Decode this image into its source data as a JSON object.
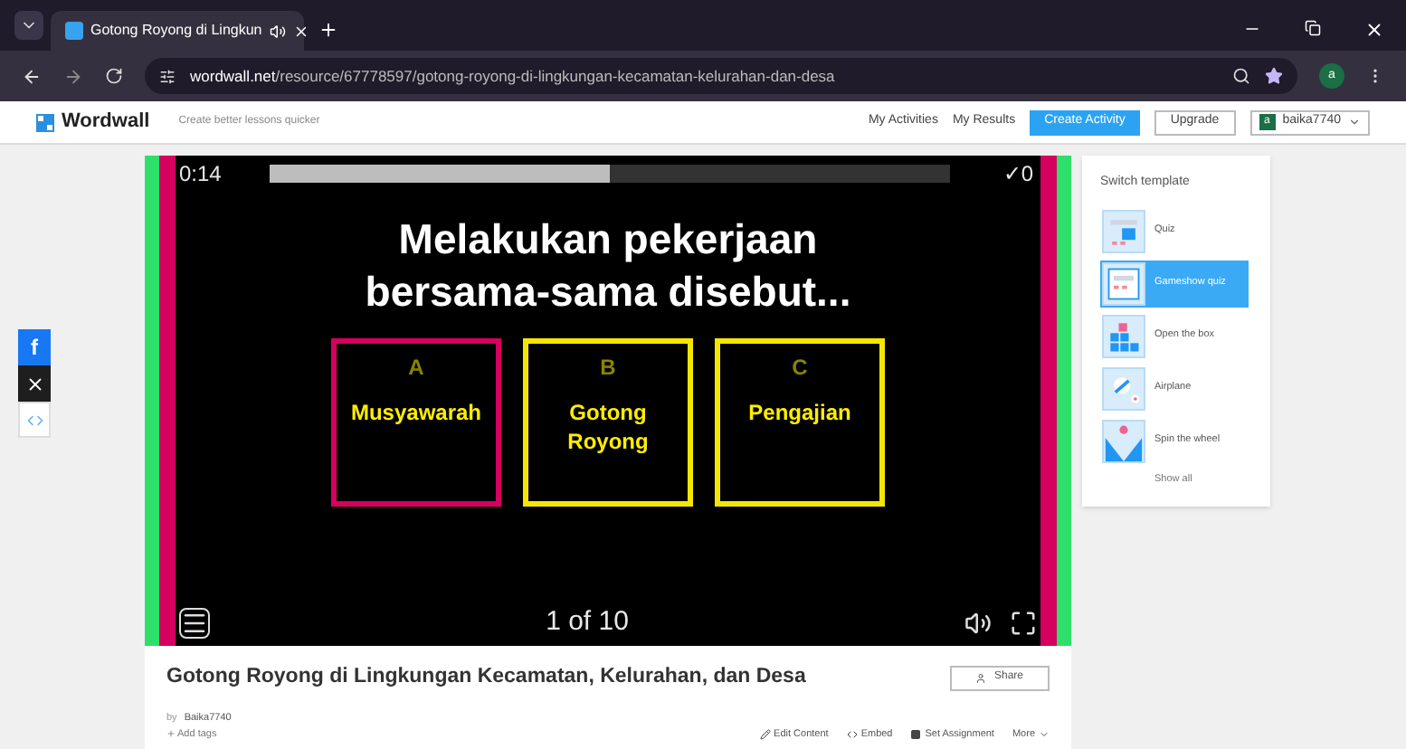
{
  "browser": {
    "tab": {
      "title": "Gotong Royong di Lingkun"
    },
    "url_host": "wordwall.net",
    "url_path": "/resource/67778597/gotong-royong-di-lingkungan-kecamatan-kelurahan-dan-desa",
    "profile": "a"
  },
  "header": {
    "logo": "Wordwall",
    "tagline": "Create better lessons quicker",
    "links": [
      "My Activities",
      "My Results"
    ],
    "create_button": "Create Activity",
    "upgrade_button": "Upgrade",
    "user": {
      "avatar": "a",
      "name": "baika7740"
    }
  },
  "share_bar": [
    {
      "kind": "facebook",
      "label": "f"
    },
    {
      "kind": "x"
    },
    {
      "kind": "embed"
    }
  ],
  "game": {
    "timer": "0:14",
    "progress": {
      "level": 0.5
    },
    "score": "✓0",
    "question": "Melakukan pekerjaan bersama-sama disebut...",
    "answers": [
      {
        "letter": "A",
        "text": "Musyawarah",
        "color": "#d6005f"
      },
      {
        "letter": "B",
        "text": "Gotong Royong",
        "color": "#f5e600"
      },
      {
        "letter": "C",
        "text": "Pengajian",
        "color": "#f5e600"
      }
    ],
    "counter": "1 of 10"
  },
  "activity": {
    "title": "Gotong Royong di Lingkungan Kecamatan, Kelurahan, dan Desa",
    "by": "by",
    "author": "Baika7740",
    "add_tags": "Add tags",
    "share_button": "Share",
    "actions": [
      {
        "kind": "edit",
        "label": "Edit Content"
      },
      {
        "kind": "embed",
        "label": "Embed"
      },
      {
        "kind": "assign",
        "label": "Set Assignment"
      },
      {
        "kind": "more",
        "label": "More"
      }
    ]
  },
  "templates": {
    "title": "Switch template",
    "items": [
      {
        "kind": "quiz",
        "label": "Quiz",
        "selected": false
      },
      {
        "kind": "gameshow",
        "label": "Gameshow quiz",
        "selected": true
      },
      {
        "kind": "box",
        "label": "Open the box",
        "selected": false
      },
      {
        "kind": "airplane",
        "label": "Airplane",
        "selected": false
      },
      {
        "kind": "wheel",
        "label": "Spin the wheel",
        "selected": false
      }
    ],
    "show_all": "Show all"
  }
}
